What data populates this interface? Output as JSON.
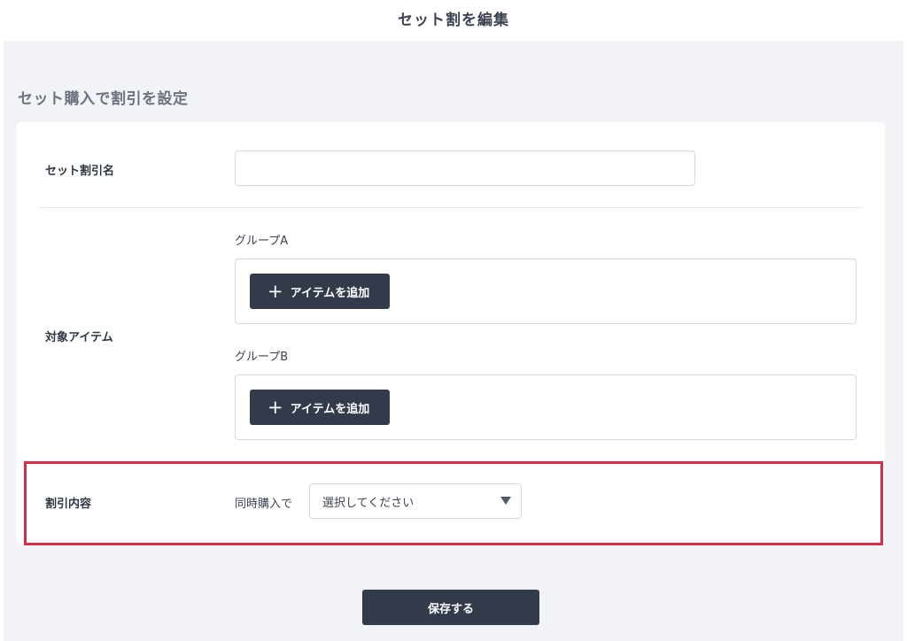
{
  "header": {
    "title": "セット割を編集"
  },
  "section": {
    "title": "セット購入で割引を設定"
  },
  "form": {
    "name_row": {
      "label": "セット割引名",
      "value": "",
      "placeholder": ""
    },
    "items_row": {
      "label": "対象アイテム",
      "groups": [
        {
          "label": "グループA",
          "add_button": "アイテムを追加",
          "icon": "plus-icon"
        },
        {
          "label": "グループB",
          "add_button": "アイテムを追加",
          "icon": "plus-icon"
        }
      ]
    },
    "discount_row": {
      "label": "割引内容",
      "sub_label": "同時購入で",
      "select_value": "選択してください",
      "icon": "caret-down-icon"
    }
  },
  "footer": {
    "save_label": "保存する"
  },
  "colors": {
    "button": "#333b4b",
    "highlight": "#d32f48",
    "background": "#f2f3f6"
  }
}
